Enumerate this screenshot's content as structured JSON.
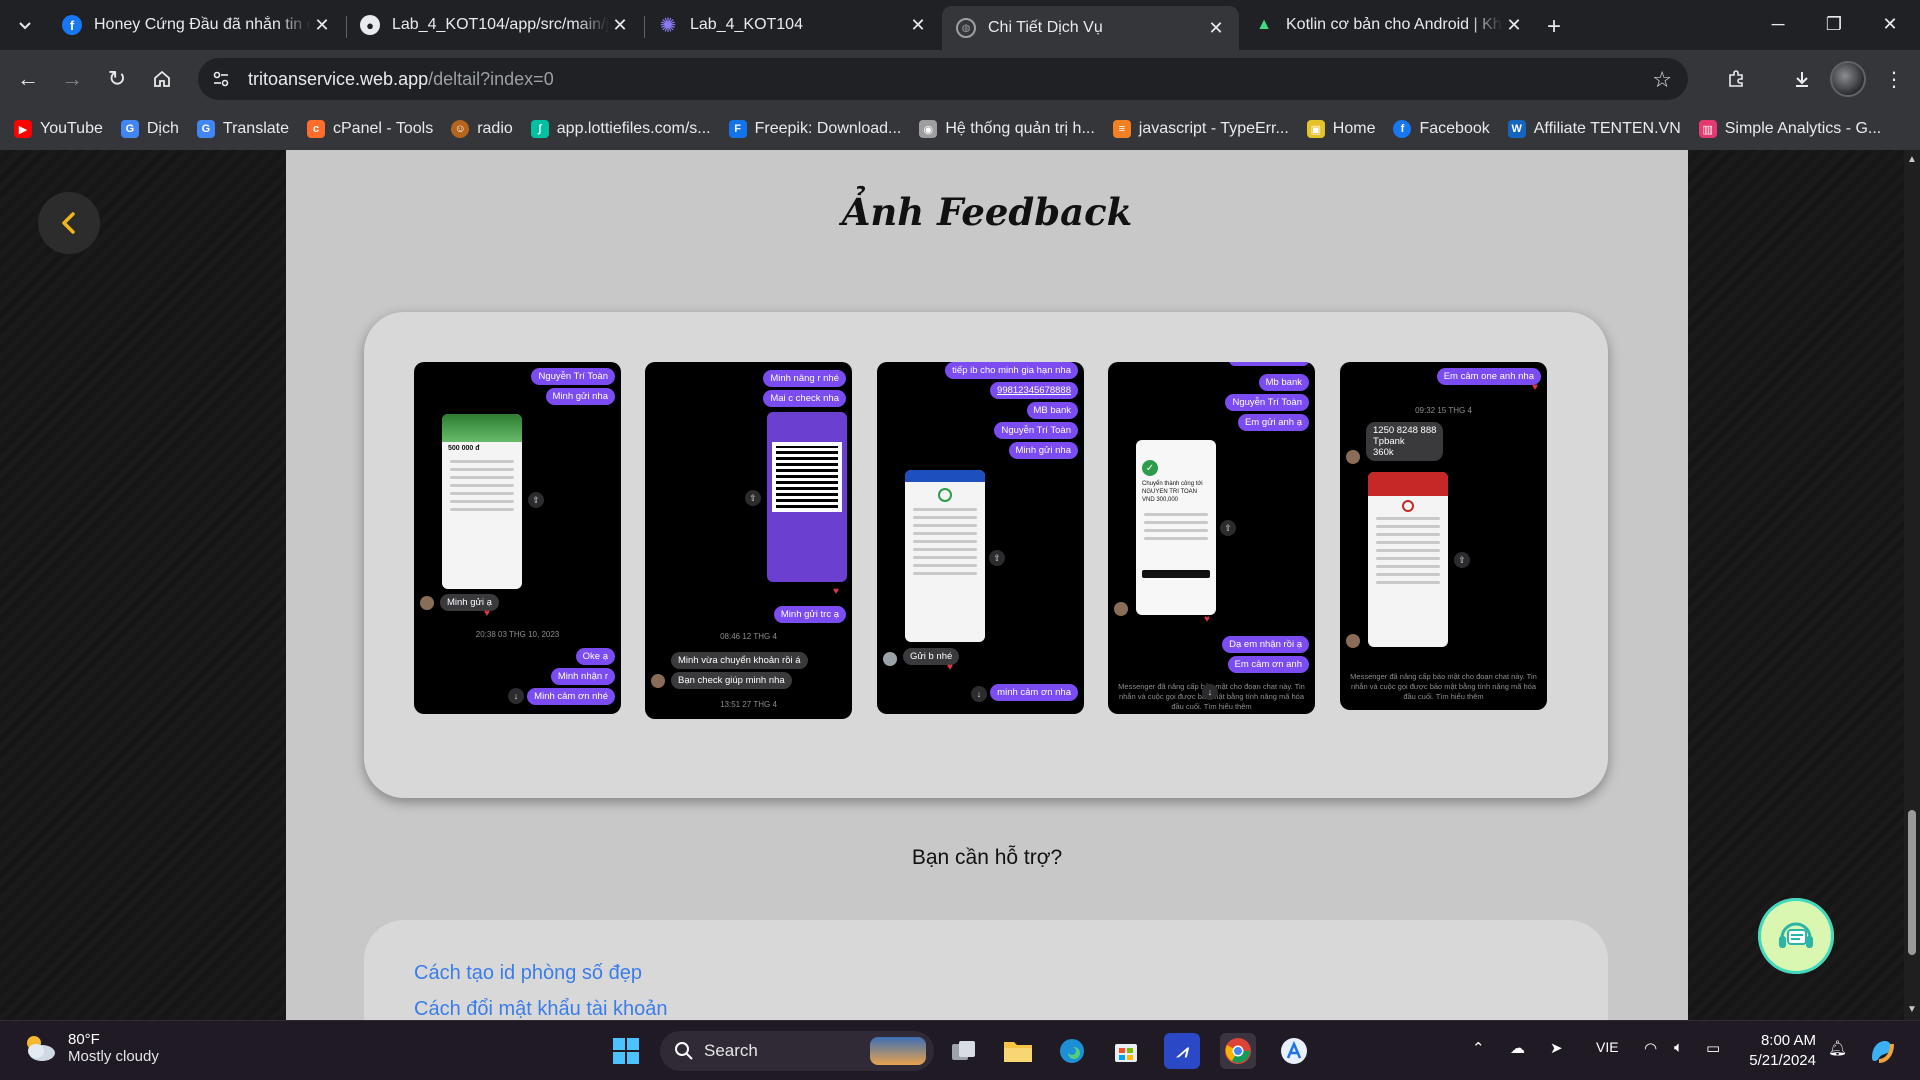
{
  "browser": {
    "tabs": [
      {
        "title": "Honey Cứng Đầu đã nhắn tin cho bạn",
        "icon": "facebook-icon",
        "active": false
      },
      {
        "title": "Lab_4_KOT104/app/src/main/java",
        "icon": "github-icon",
        "active": false
      },
      {
        "title": "Lab_4_KOT104",
        "icon": "ai-spark-icon",
        "active": false
      },
      {
        "title": "Chi Tiết Dịch Vụ",
        "icon": "globe-icon",
        "active": true
      },
      {
        "title": "Kotlin cơ bản cho Android | Khóa học",
        "icon": "android-icon",
        "active": false
      }
    ],
    "url_domain": "tritoanservice.web.app",
    "url_path": "/deltail?index=0",
    "bookmarks": [
      {
        "label": "YouTube",
        "color": "#ff0000"
      },
      {
        "label": "Dịch",
        "color": "#4285f4"
      },
      {
        "label": "Translate",
        "color": "#4285f4"
      },
      {
        "label": "cPanel - Tools",
        "color": "#ff6c2c"
      },
      {
        "label": "radio",
        "color": "#b5651d"
      },
      {
        "label": "app.lottiefiles.com/s...",
        "color": "#00c1a2"
      },
      {
        "label": "Freepik: Download...",
        "color": "#1273eb"
      },
      {
        "label": "Hệ thống quản trị h...",
        "color": "#9e9e9e"
      },
      {
        "label": "javascript - TypeErr...",
        "color": "#f48024"
      },
      {
        "label": "Home",
        "color": "#e6c229"
      },
      {
        "label": "Facebook",
        "color": "#1877f2"
      },
      {
        "label": "Affiliate TENTEN.VN",
        "color": "#1565c0"
      },
      {
        "label": "Simple Analytics - G...",
        "color": "#e53970"
      }
    ]
  },
  "page": {
    "feedback_title": "Ảnh Feedback",
    "support_question": "Bạn cần hỗ trợ?",
    "help_links": [
      "Cách tạo id phòng số đẹp",
      "Cách đổi mật khẩu tài khoản"
    ],
    "screenshots": [
      {
        "bubbles_top": [
          "Nguyễn Trí Toàn",
          "Minh gửi nha"
        ],
        "grey_bubbles": [
          "Minh gửi ạ"
        ],
        "timestamp": "20:38 03 THG 10, 2023",
        "bubbles_bottom": [
          "Oke ạ",
          "Minh nhận r",
          "Minh cảm ơn nhé"
        ],
        "receipt_amount": "500 000 đ"
      },
      {
        "bubbles_top": [
          "Minh nâng r nhé",
          "Mai c check nha"
        ],
        "grey_bubbles": [
          "Minh vừa chuyển khoản rồi á",
          "Bạn check giúp minh nha"
        ],
        "timestamp": "08:46 12 THG 4",
        "timestamp2": "13:51 27 THG 4",
        "bubbles_bottom": [
          "Minh gửi trc ạ"
        ]
      },
      {
        "bubbles_top": [
          "tiếp ib cho minh gia hạn nha",
          "99812345678888",
          "MB bank",
          "Nguyễn Trí Toàn",
          "Minh gửi nha"
        ],
        "grey_bubbles": [
          "Gửi b nhé"
        ],
        "bubbles_bottom": [
          "minh cảm ơn nha"
        ]
      },
      {
        "bubbles_top": [
          "Mb bank",
          "Nguyễn Trí Toàn",
          "Em gửi anh ạ"
        ],
        "receipt_text": "Chuyển thành công tới NGUYEN TRI TOAN VND 300,000",
        "bubbles_bottom": [
          "Dạ em nhận rồi ạ",
          "Em cảm ơn anh"
        ],
        "note": "Messenger đã nâng cấp bảo mật cho đoạn chat này. Tin nhắn và cuộc gọi được bảo mật bằng tính năng mã hóa đầu cuối. Tìm hiểu thêm"
      },
      {
        "bubbles_top": [
          "Em cảm one anh nha"
        ],
        "timestamp": "09:32 15 THG 4",
        "grey_bubbles": [
          "1250 8248 888\nTpbank\n360k"
        ],
        "note": "Messenger đã nâng cấp bảo mật cho đoạn chat này. Tin nhắn và cuộc gọi được bảo mật bằng tính năng mã hóa đầu cuối. Tìm hiểu thêm"
      }
    ]
  },
  "taskbar": {
    "weather_temp": "80°F",
    "weather_desc": "Mostly cloudy",
    "search_label": "Search",
    "language": "VIE",
    "time": "8:00 AM",
    "date": "5/21/2024"
  }
}
